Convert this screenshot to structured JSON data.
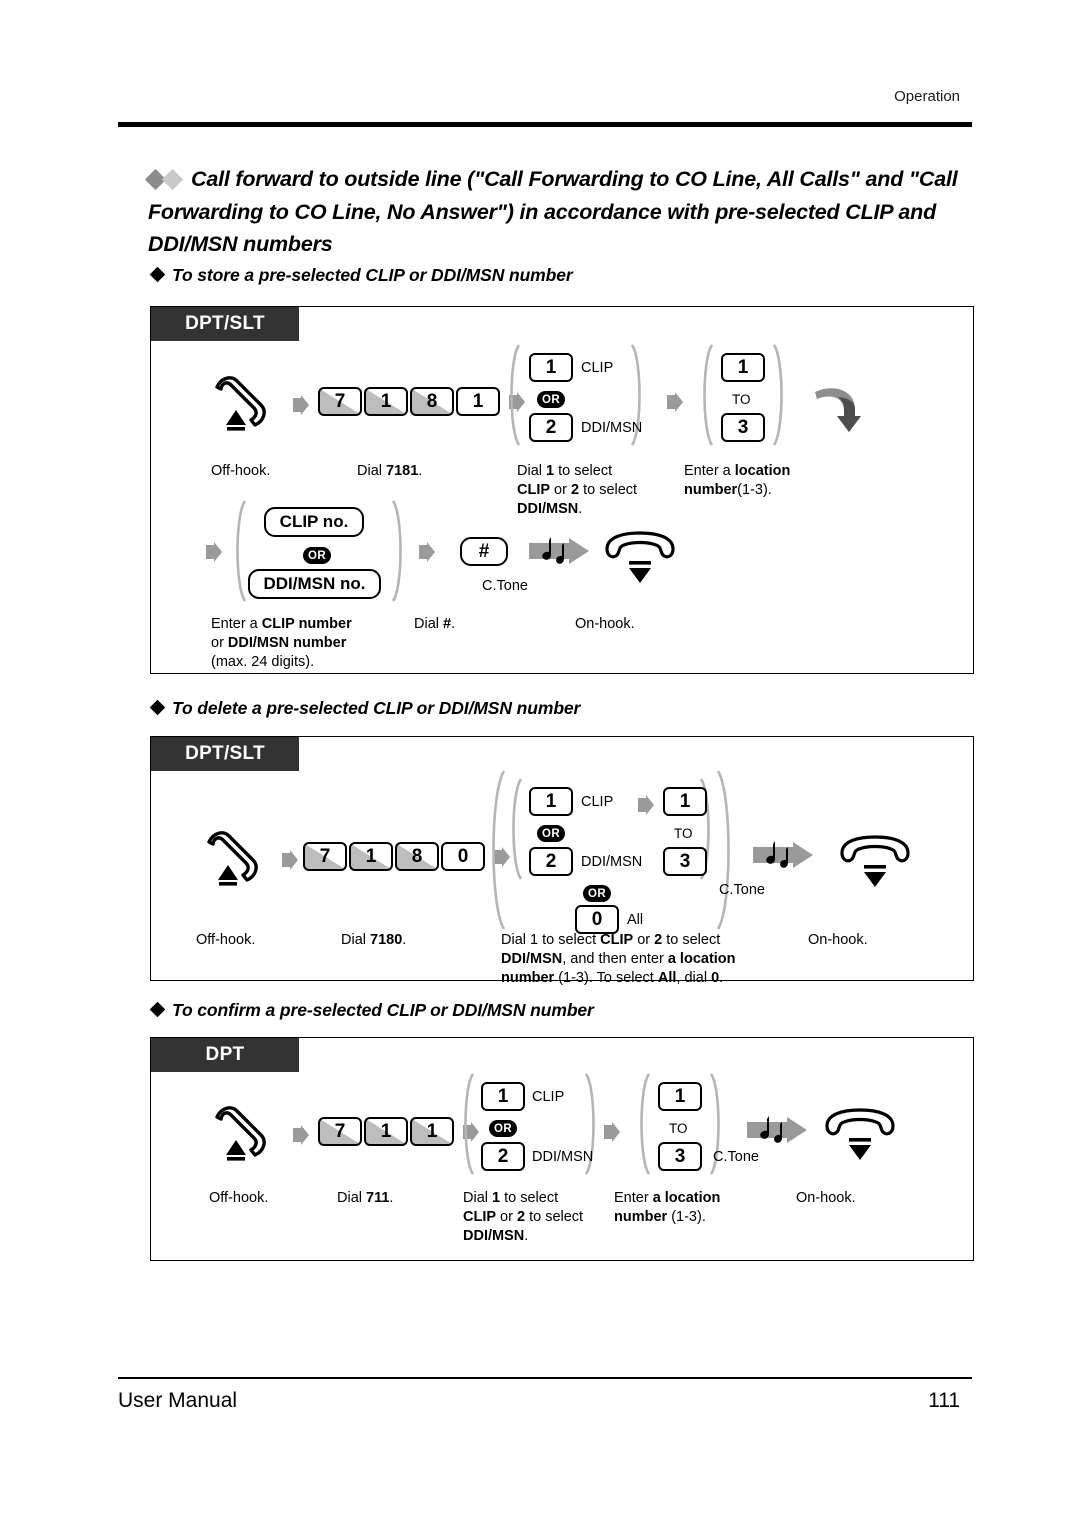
{
  "header": {
    "section": "Operation"
  },
  "footer": {
    "left": "User Manual",
    "page": "111"
  },
  "title": "Call forward to outside line (\"Call Forwarding to CO Line, All Calls\" and \"Call Forwarding to CO Line, No Answer\") in accordance with pre-selected CLIP and DDI/MSN numbers",
  "sections": [
    {
      "heading": "To store a pre-selected CLIP or DDI/MSN number",
      "tab": "DPT/SLT",
      "steps_row1": [
        {
          "icon": "off-hook-handset-icon",
          "caption": "Off-hook."
        },
        {
          "keys": [
            "7",
            "1",
            "8",
            "1"
          ],
          "caption_plain": "Dial ",
          "caption_bold": "7181",
          "caption_tail": "."
        },
        {
          "keys": [
            "1",
            "2"
          ],
          "key_labels": [
            "CLIP",
            "DDI/MSN"
          ],
          "or": "OR",
          "caption_lines": [
            "Dial 1 to select",
            "CLIP or 2 to select",
            "DDI/MSN."
          ]
        },
        {
          "keys": [
            "1",
            "3"
          ],
          "mid": "TO",
          "caption_lines": [
            "Enter a location",
            "number(1-3)."
          ]
        },
        {
          "icon": "wrap-arrow-icon"
        }
      ],
      "steps_row2": [
        {
          "keys": [
            "CLIP no.",
            "DDI/MSN no."
          ],
          "or": "OR",
          "caption_lines": [
            "Enter a CLIP number",
            "or DDI/MSN number",
            "(max. 24 digits)."
          ]
        },
        {
          "keys": [
            "#"
          ],
          "caption_lines": [
            "Dial #."
          ]
        },
        {
          "icon": "confirmation-tone-icon",
          "label": "C.Tone"
        },
        {
          "icon": "on-hook-handset-icon",
          "caption": "On-hook."
        }
      ]
    },
    {
      "heading": "To delete a pre-selected CLIP or DDI/MSN number",
      "tab": "DPT/SLT",
      "steps": [
        {
          "icon": "off-hook-handset-icon",
          "caption": "Off-hook."
        },
        {
          "keys": [
            "7",
            "1",
            "8",
            "0"
          ],
          "caption_plain": "Dial ",
          "caption_bold": "7180",
          "caption_tail": "."
        },
        {
          "keys": [
            "1",
            "2",
            "0",
            "1",
            "3"
          ],
          "key_labels": [
            "CLIP",
            "DDI/MSN",
            "All"
          ],
          "mid": "TO",
          "or": "OR",
          "caption_lines": [
            "Dial 1 to select CLIP or 2 to select",
            "DDI/MSN, and then enter a location",
            "number (1-3). To select All, dial 0."
          ]
        },
        {
          "icon": "confirmation-tone-icon",
          "label": "C.Tone"
        },
        {
          "icon": "on-hook-handset-icon",
          "caption": "On-hook."
        }
      ]
    },
    {
      "heading": "To confirm a pre-selected CLIP or DDI/MSN number",
      "tab": "DPT",
      "steps": [
        {
          "icon": "off-hook-handset-icon",
          "caption": "Off-hook."
        },
        {
          "keys": [
            "7",
            "1",
            "1"
          ],
          "caption_plain": "Dial ",
          "caption_bold": "711",
          "caption_tail": "."
        },
        {
          "keys": [
            "1",
            "2"
          ],
          "key_labels": [
            "CLIP",
            "DDI/MSN"
          ],
          "or": "OR",
          "caption_lines": [
            "Dial 1 to select",
            "CLIP or 2 to select",
            "DDI/MSN."
          ]
        },
        {
          "keys": [
            "1",
            "3"
          ],
          "mid": "TO",
          "caption_lines": [
            "Enter a location",
            "number (1-3)."
          ]
        },
        {
          "icon": "confirmation-tone-icon",
          "label": "C.Tone"
        },
        {
          "icon": "on-hook-handset-icon",
          "caption": "On-hook."
        }
      ]
    }
  ],
  "labels": {
    "clip": "CLIP",
    "ddimsn": "DDI/MSN",
    "all": "All",
    "to": "TO",
    "or": "OR",
    "ctone": "C.Tone",
    "offhook": "Off-hook.",
    "onhook": "On-hook.",
    "hash": "#",
    "clip_no": "CLIP no.",
    "ddimsn_no": "DDI/MSN no."
  }
}
